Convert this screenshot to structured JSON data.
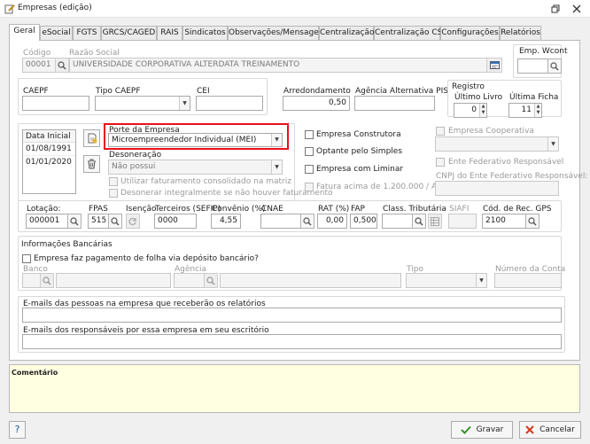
{
  "window": {
    "title": "Empresas (edição)"
  },
  "tabs": [
    "Geral",
    "eSocial",
    "FGTS",
    "GRCS/CAGED",
    "RAIS",
    "Sindicatos",
    "Observações/Mensagens",
    "Centralização",
    "Centralização CS",
    "Configurações",
    "Relatórios"
  ],
  "labels": {
    "codigo": "Código",
    "razao_social": "Razão Social",
    "emp_wcont": "Emp. Wcont",
    "caepf": "CAEPF",
    "tipo_caepf": "Tipo CAEPF",
    "cei": "CEI",
    "arredondamento": "Arredondamento",
    "agencia_alt_pis": "Agência Alternativa PIS",
    "registro": "Registro",
    "ultimo_livro": "Último Livro",
    "ultima_ficha": "Última Ficha",
    "data_inicial": "Data Inicial",
    "porte_empresa": "Porte da Empresa",
    "desoneracao": "Desoneração",
    "utilizar_faturamento": "Utilizar faturamento consolidado na matriz",
    "desonerar_integralmente": "Desonerar integralmente se não houver faturamento",
    "empresa_construtora": "Empresa Construtora",
    "optante_simples": "Optante pelo Simples",
    "empresa_liminar": "Empresa com Liminar",
    "fatura_acima": "Fatura acima de 1.200.000 / Ano",
    "empresa_cooperativa": "Empresa Cooperativa",
    "ente_federativo": "Ente Federativo Responsável",
    "cnpj_ente": "CNPJ do Ente Federativo Responsável:",
    "lotacao": "Lotação:",
    "fpas": "FPAS",
    "isencao": "Isenção",
    "terceiros": "Terceiros (SEFIP)",
    "convenio": "Convênio (%)",
    "cnae": "CNAE",
    "rat": "RAT (%)",
    "fap": "FAP",
    "class_tributaria": "Class. Tributária",
    "siafi": "SIAFI",
    "cod_rec_gps": "Cód. de Rec. GPS",
    "info_bancarias": "Informações Bancárias",
    "folha_deposito": "Empresa faz pagamento de folha via depósito bancário?",
    "banco": "Banco",
    "agencia": "Agência",
    "tipo": "Tipo",
    "numero_conta": "Número da Conta",
    "emails_pessoas": "E-mails das pessoas na empresa que receberão os relatórios",
    "emails_responsaveis": "E-mails dos responsáveis por essa empresa em seu escritório",
    "comentario": "Comentário"
  },
  "values": {
    "codigo": "00001",
    "razao_social": "UNIVERSIDADE CORPORATIVA ALTERDATA TREINAMENTO",
    "arredondamento": "0,50",
    "ultimo_livro": "0",
    "ultima_ficha": "11",
    "datas": [
      "01/08/1991",
      "01/01/2020"
    ],
    "porte_empresa": "Microempreendedor Individual (MEI)",
    "desoneracao": "Não possui",
    "lotacao": "000001",
    "fpas": "515",
    "terceiros": "0000",
    "convenio": "4,55",
    "rat": "0,00",
    "fap": "0,5000",
    "cod_rec_gps": "2100"
  },
  "buttons": {
    "help": "?",
    "gravar": "Gravar",
    "cancelar": "Cancelar"
  },
  "colors": {
    "highlight": "#e8101b",
    "comment_bg": "#ffffe1",
    "ok_green": "#3a8f2a",
    "cancel_red": "#d23a1e"
  }
}
